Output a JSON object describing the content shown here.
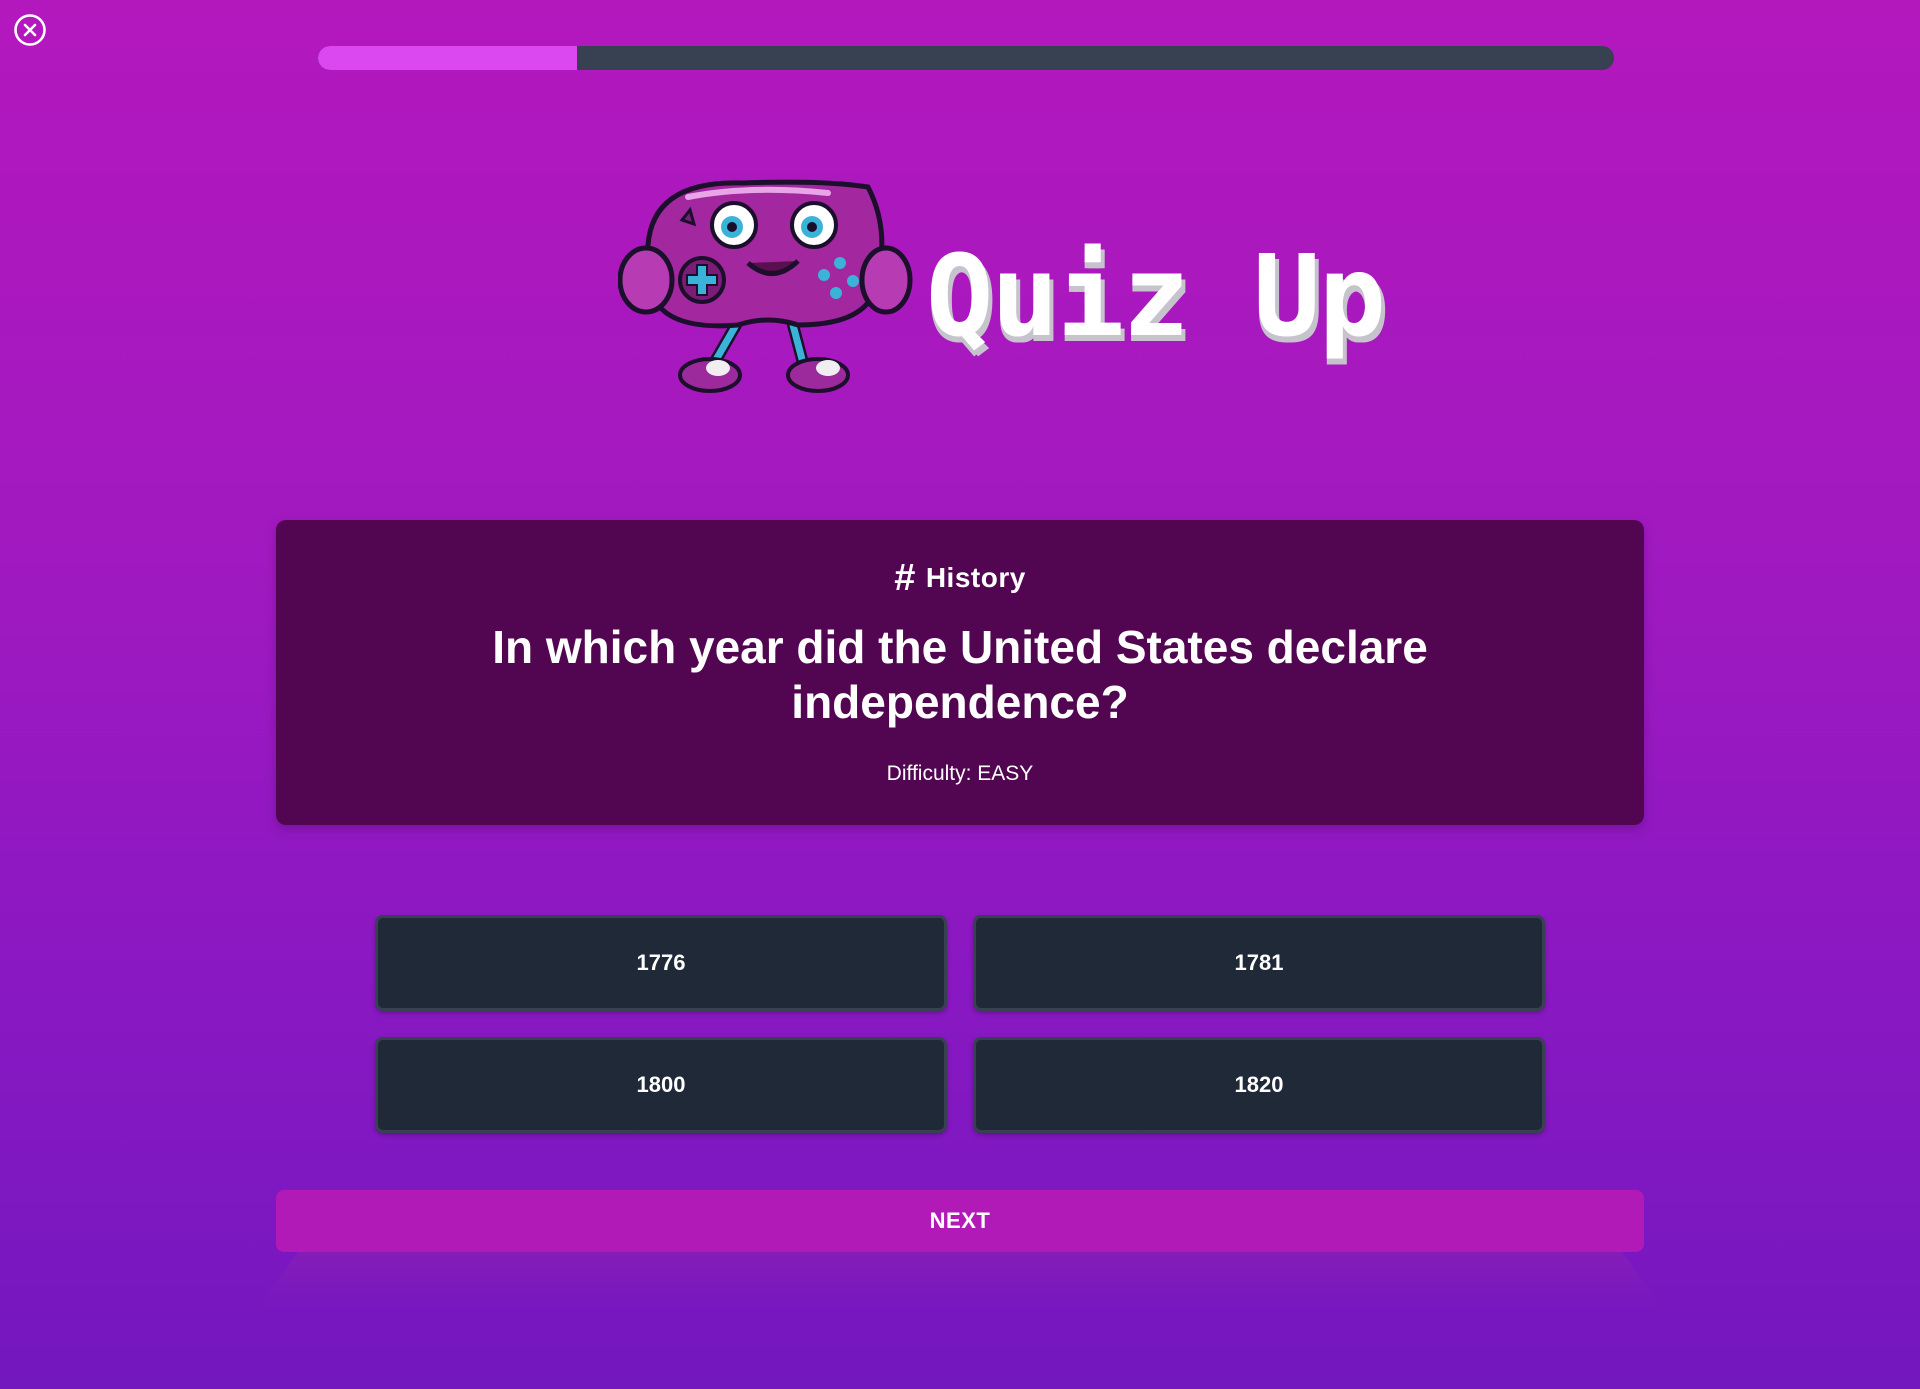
{
  "header": {
    "close_icon": "close-circle-icon",
    "progress": 0.2
  },
  "brand": {
    "title": "Quiz Up",
    "mascot": "gamepad-mascot"
  },
  "question": {
    "category_icon": "hash-icon",
    "category": "History",
    "text": "In which year did the United States declare independence?",
    "difficulty": "Difficulty: EASY"
  },
  "answers": [
    {
      "label": "1776"
    },
    {
      "label": "1781"
    },
    {
      "label": "1800"
    },
    {
      "label": "1820"
    }
  ],
  "footer": {
    "next_label": "NEXT"
  },
  "colors": {
    "progress_fill": "#dc48f0",
    "progress_track": "#374151",
    "card_bg": "#520652",
    "answer_bg": "#1f2937",
    "next_bg": "#b21ab8"
  }
}
